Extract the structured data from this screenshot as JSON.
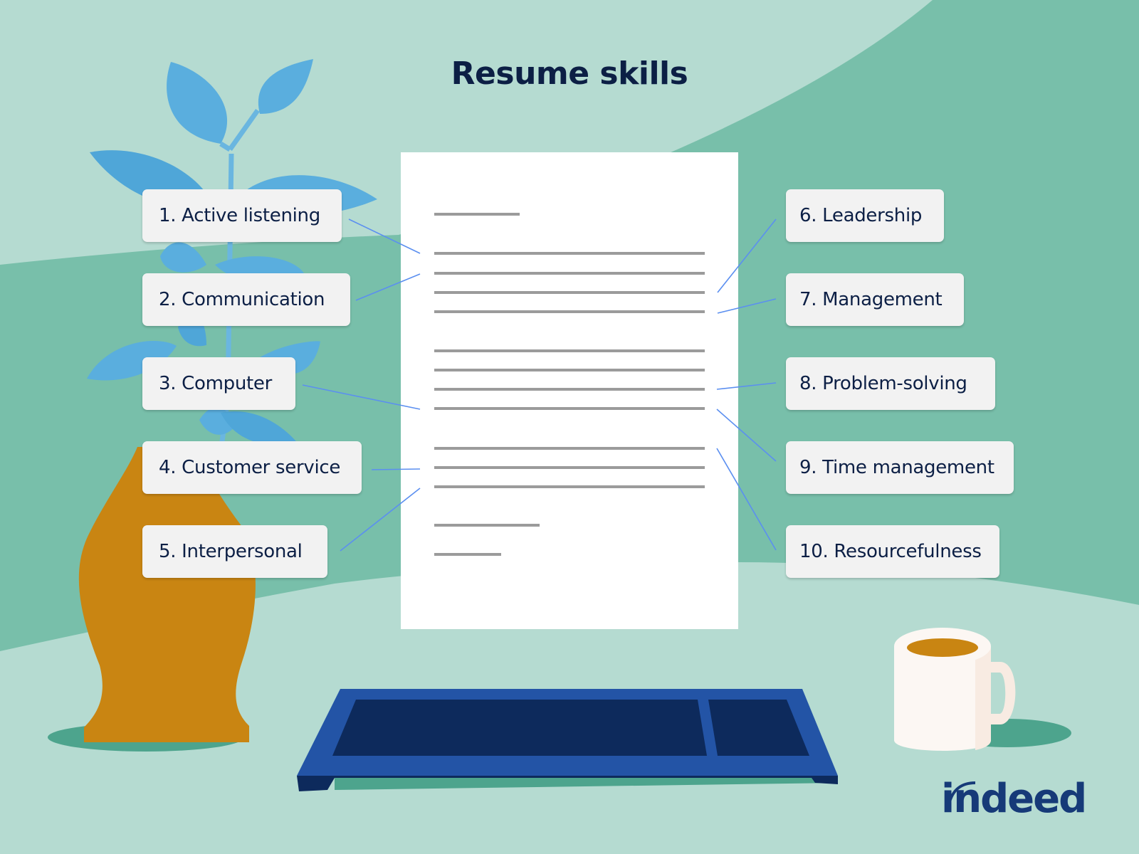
{
  "title": "Resume skills",
  "skills_left": [
    {
      "label": "1. Active listening"
    },
    {
      "label": "2. Communication"
    },
    {
      "label": "3. Computer"
    },
    {
      "label": "4. Customer service"
    },
    {
      "label": "5. Interpersonal"
    }
  ],
  "skills_right": [
    {
      "label": "6. Leadership"
    },
    {
      "label": "7. Management"
    },
    {
      "label": "8. Problem-solving"
    },
    {
      "label": "9. Time management"
    },
    {
      "label": "10. Resourcefulness"
    }
  ],
  "logo": {
    "text": "indeed"
  },
  "colors": {
    "background_light": "#b5dbd1",
    "background_mid": "#78bfaa",
    "title_text": "#0c1f45",
    "label_bg": "#f2f2f2",
    "connector_line": "#5b8ff0",
    "leaf": "#5aaede",
    "vase": "#c98512",
    "keyboard_frame": "#2354a6",
    "keyboard_keys": "#0d2a5c",
    "mug": "#fcf7f3",
    "coffee": "#c98512",
    "logo": "#163a78"
  },
  "icons": {
    "plant": "plant-icon",
    "vase": "vase-icon",
    "resume": "document-icon",
    "keyboard": "keyboard-icon",
    "mug": "coffee-mug-icon",
    "logo": "indeed-logo"
  }
}
